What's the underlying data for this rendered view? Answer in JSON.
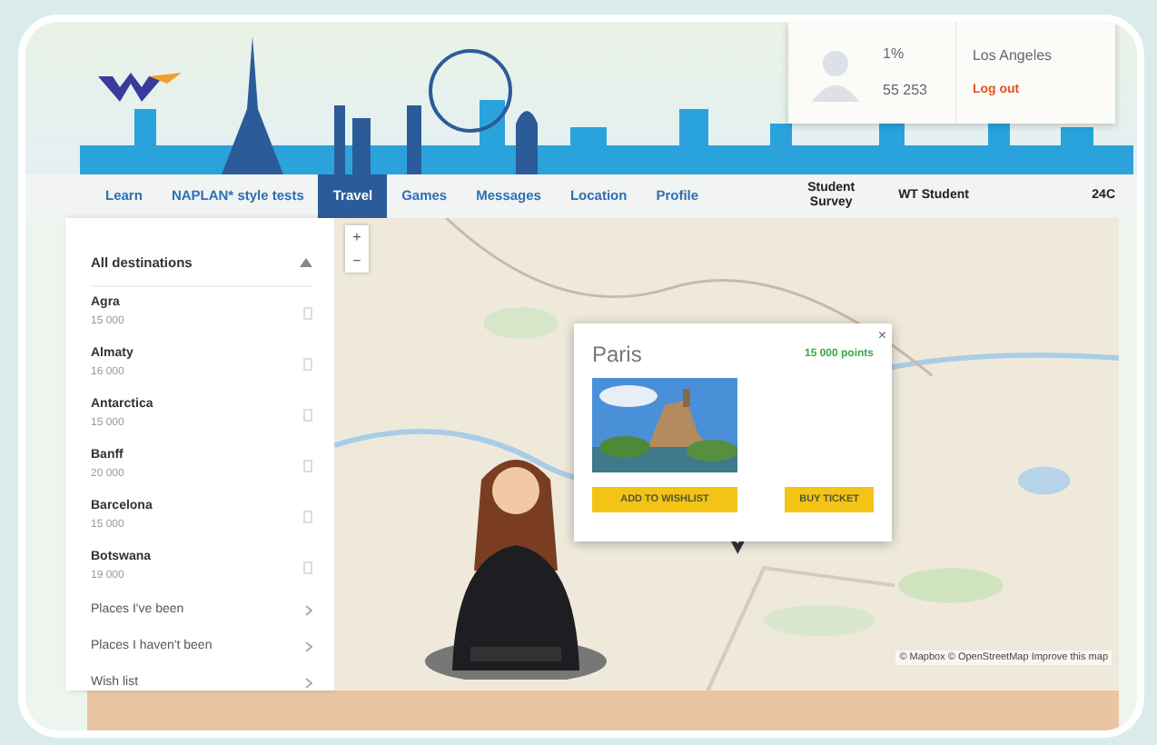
{
  "profile": {
    "stat_1": "1%",
    "stat_2": "55 253",
    "city": "Los Angeles",
    "logout": "Log out"
  },
  "nav_tabs": [
    {
      "label": "Learn",
      "selected": false
    },
    {
      "label": "NAPLAN* style tests",
      "selected": false
    },
    {
      "label": "Travel",
      "selected": true
    },
    {
      "label": "Games",
      "selected": false
    },
    {
      "label": "Messages",
      "selected": false
    },
    {
      "label": "Location",
      "selected": false
    },
    {
      "label": "Profile",
      "selected": false
    }
  ],
  "nav_extras": [
    "Student Survey",
    "WT Student",
    "24C"
  ],
  "sidebar": {
    "filter": "All destinations",
    "expanded": true,
    "destinations": [
      {
        "name": "Agra",
        "points": "15 000"
      },
      {
        "name": "Almaty",
        "points": "16 000"
      },
      {
        "name": "Antarctica",
        "points": "15 000"
      },
      {
        "name": "Banff",
        "points": "20 000"
      },
      {
        "name": "Barcelona",
        "points": "15 000"
      },
      {
        "name": "Botswana",
        "points": "19 000"
      }
    ],
    "lists": [
      "Places I've been",
      "Places I haven't been",
      "Wish list"
    ]
  },
  "map": {
    "zoom_in": "+",
    "zoom_out": "−",
    "attribution": "© Mapbox © OpenStreetMap Improve this map"
  },
  "popup": {
    "title": "Paris",
    "points": "15 000 points",
    "close": "×",
    "buttons": [
      "ADD TO WISHLIST",
      "BUY TICKET"
    ]
  }
}
